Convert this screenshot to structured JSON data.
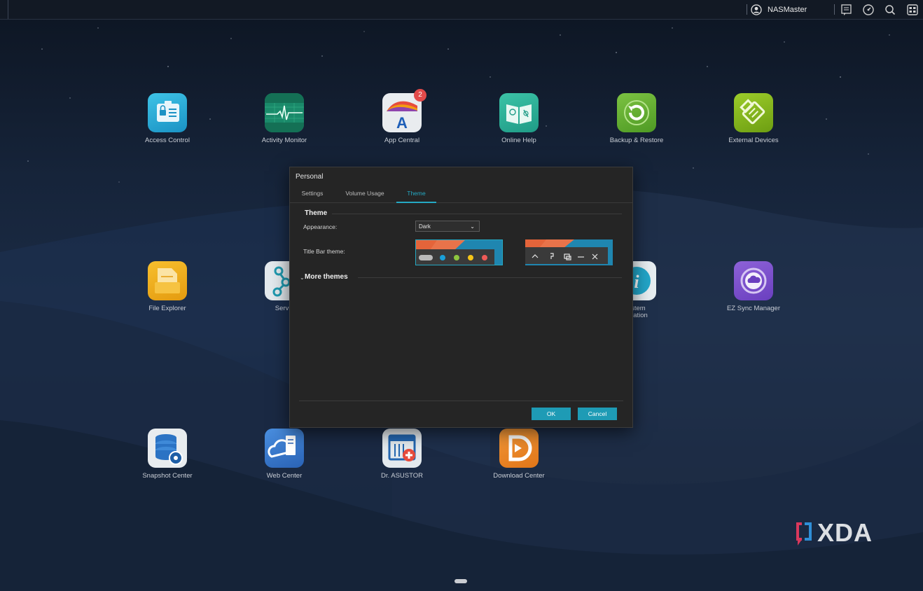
{
  "topbar": {
    "username": "NASMaster"
  },
  "desktop": {
    "apps": [
      {
        "label": "Access Control",
        "label2": ""
      },
      {
        "label": "Activity Monitor",
        "label2": ""
      },
      {
        "label": "App Central",
        "label2": "",
        "badge": "2"
      },
      {
        "label": "Online Help",
        "label2": ""
      },
      {
        "label": "Backup & Restore",
        "label2": ""
      },
      {
        "label": "External Devices",
        "label2": ""
      },
      {
        "label": "File Explorer",
        "label2": ""
      },
      {
        "label": "Servic",
        "label2": ""
      },
      {
        "label": "ystem",
        "label2": "rmation"
      },
      {
        "label": "EZ Sync Manager",
        "label2": ""
      },
      {
        "label": "Snapshot Center",
        "label2": ""
      },
      {
        "label": "Web Center",
        "label2": ""
      },
      {
        "label": "Dr. ASUSTOR",
        "label2": ""
      },
      {
        "label": "Download Center",
        "label2": ""
      }
    ]
  },
  "dialog": {
    "title": "Personal",
    "tabs": [
      {
        "label": "Settings"
      },
      {
        "label": "Volume Usage"
      },
      {
        "label": "Theme"
      }
    ],
    "active_tab": "Theme",
    "section_title": "Theme",
    "appearance_label": "Appearance:",
    "appearance_value": "Dark",
    "titlebar_label": "Title Bar theme:",
    "more_themes": "More themes",
    "ok_label": "OK",
    "cancel_label": "Cancel"
  },
  "watermark": {
    "text": "XDA"
  },
  "colors": {
    "accent": "#1e9bb5",
    "tab_active": "#25a9c3",
    "badge": "#e24a4a"
  }
}
